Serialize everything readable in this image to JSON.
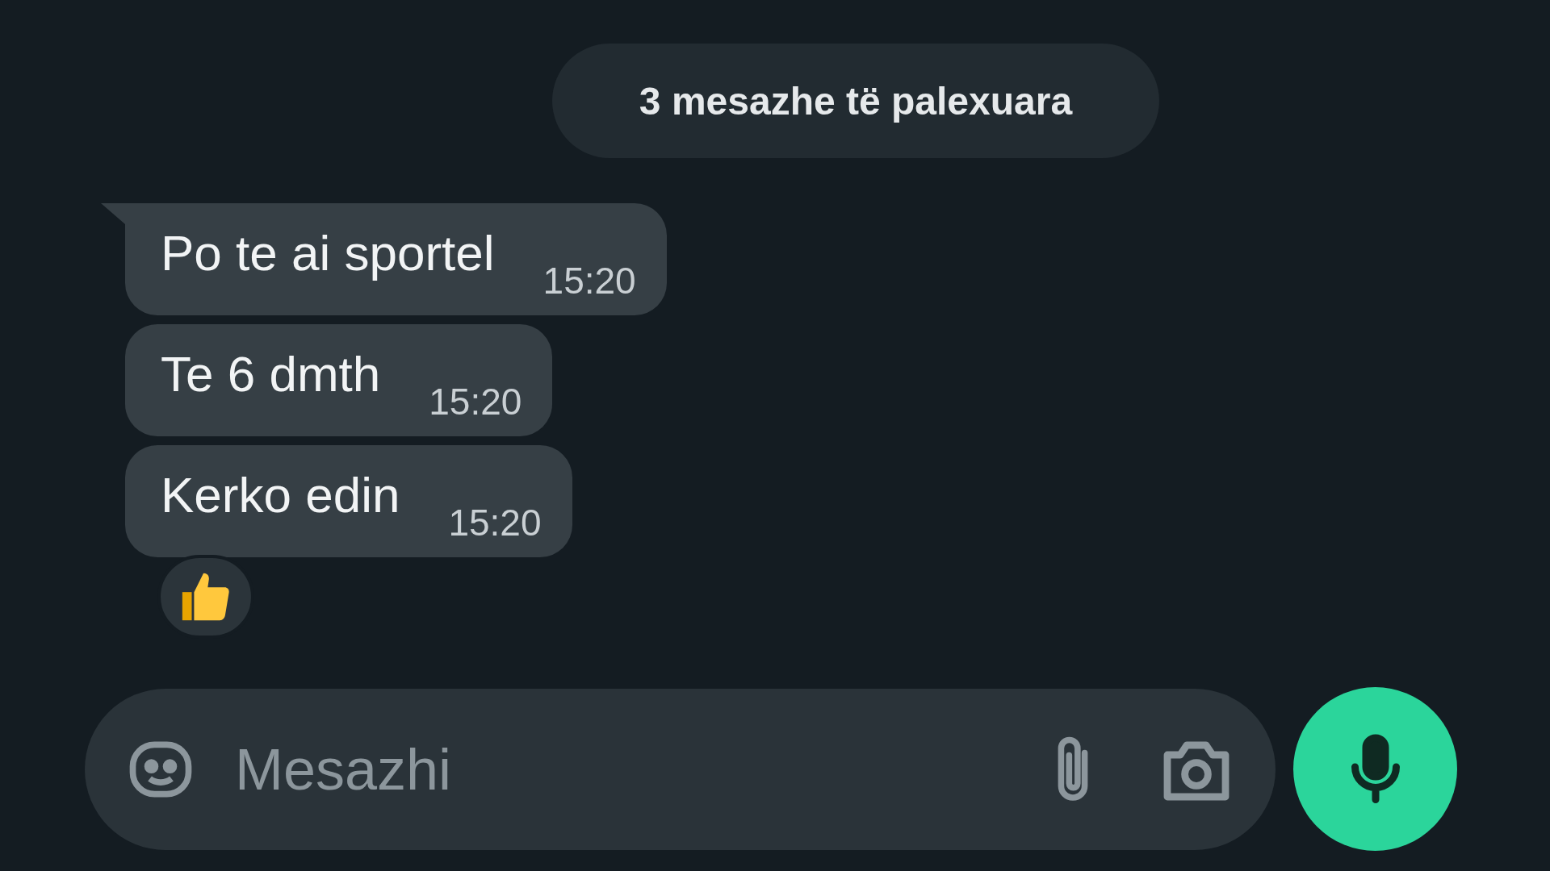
{
  "unread_banner": {
    "text": "3 mesazhe të palexuara"
  },
  "messages": [
    {
      "text": "Po te ai sportel",
      "time": "15:20",
      "tail": true
    },
    {
      "text": "Te 6 dmth",
      "time": "15:20",
      "tail": false
    },
    {
      "text": "Kerko edin",
      "time": "15:20",
      "tail": false
    }
  ],
  "composer": {
    "placeholder": "Mesazhi"
  }
}
